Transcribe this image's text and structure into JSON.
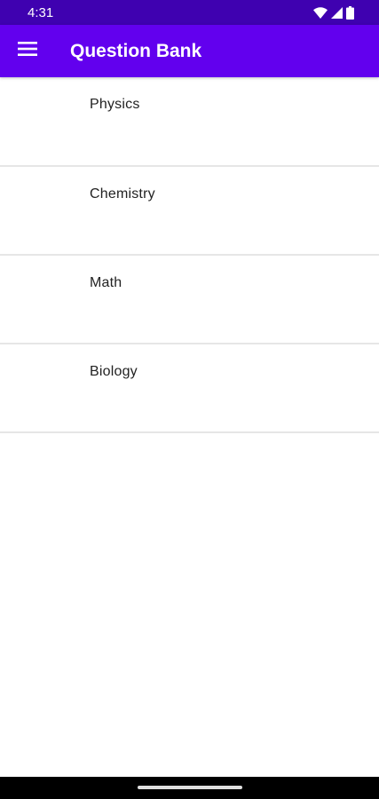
{
  "status_bar": {
    "time": "4:31",
    "icons": [
      "wifi-icon",
      "signal-icon",
      "battery-icon"
    ]
  },
  "app_bar": {
    "title": "Question Bank",
    "menu_icon": "menu-icon"
  },
  "subjects": [
    {
      "label": "Physics"
    },
    {
      "label": "Chemistry"
    },
    {
      "label": "Math"
    },
    {
      "label": "Biology"
    }
  ],
  "colors": {
    "status_bar": "#3f01b0",
    "app_bar": "#6200ee",
    "divider": "#e6e6e6",
    "text": "#222222"
  }
}
